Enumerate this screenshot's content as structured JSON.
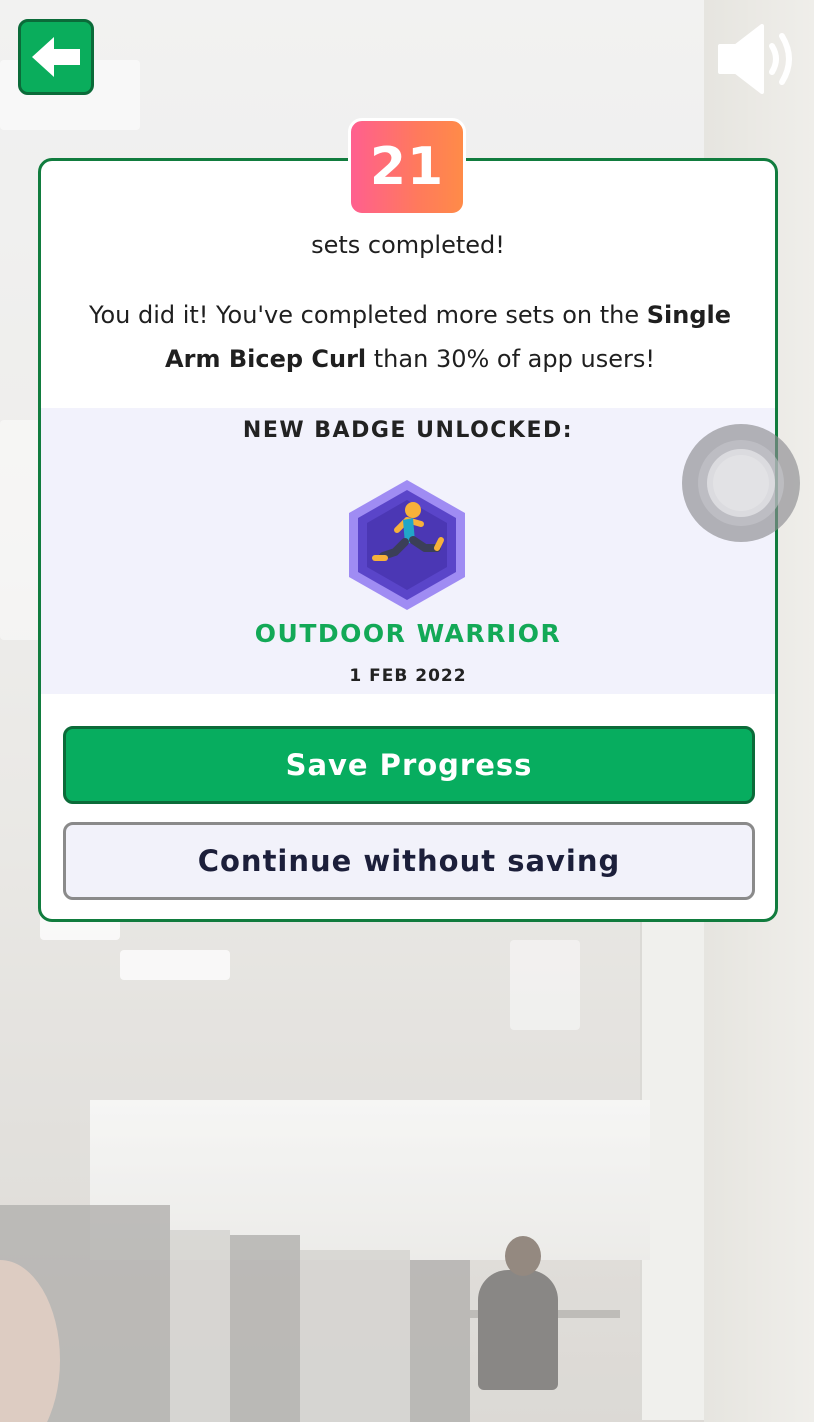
{
  "top_bar": {
    "back_icon": "arrow-left-icon",
    "sound_icon": "speaker-volume-icon"
  },
  "progress": {
    "sets_count": "21",
    "sets_label": "sets completed!",
    "message_intro": "You did it! You've completed more sets on the ",
    "exercise_name": "Single Arm Bicep Curl",
    "message_outro": " than 30% of app users!"
  },
  "badge": {
    "heading": "NEW BADGE UNLOCKED:",
    "icon": "running-person-hexagon-icon",
    "name": "OUTDOOR WARRIOR",
    "date": "1 FEB 2022"
  },
  "actions": {
    "save_label": "Save Progress",
    "continue_label": "Continue without saving"
  },
  "colors": {
    "primary_green": "#07ad5f",
    "dark_green_border": "#0b6b39",
    "counter_gradient_start": "#ff5f8f",
    "counter_gradient_end": "#ff8b48",
    "badge_purple": "#5a45c9",
    "badge_panel_bg": "#f2f2fc"
  },
  "overlay": {
    "assistive_touch_icon": "assistive-touch-icon"
  }
}
